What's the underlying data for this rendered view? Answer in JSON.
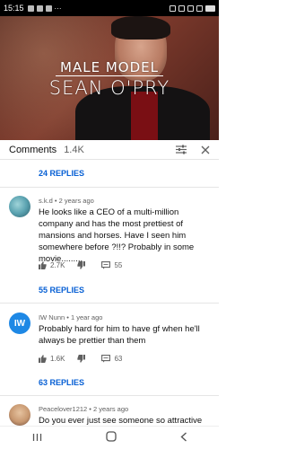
{
  "status_bar": {
    "time": "15:15",
    "battery": "",
    "more": "···"
  },
  "video": {
    "line1": "MALE MODEL",
    "line2": "SEAN O'PRY"
  },
  "comments_header": {
    "title": "Comments",
    "count": "1.4K"
  },
  "comments": [
    {
      "replies_above": "24 REPLIES",
      "author_meta": "s.k.d • 2 years ago",
      "text": "He looks like a CEO of a multi-million company and has the most prettiest of mansions and horses. Have I seen him somewhere before ?!!? Probably in some movie.........",
      "likes": "2.7K",
      "replies_count": "55",
      "replies_link": "55 REPLIES",
      "avatar_letter": ""
    },
    {
      "author_meta": "IW Nunn • 1 year ago",
      "text": "Probably hard for him to have gf when he'll always be prettier than them",
      "likes": "1.6K",
      "replies_count": "63",
      "replies_link": "63 REPLIES",
      "avatar_letter": "IW"
    },
    {
      "author_meta": "Peacelover1212 • 2 years ago",
      "text": "Do you ever just see someone so attractive"
    }
  ],
  "icons": {
    "filter": "filter-sliders-icon",
    "close": "close-icon",
    "like": "thumbs-up-icon",
    "dislike": "thumbs-down-icon",
    "reply": "reply-comment-icon",
    "nav_recents": "recents-icon",
    "nav_home": "home-icon",
    "nav_back": "back-icon"
  },
  "colors": {
    "link_blue": "#065fd4",
    "avatar_blue": "#1e88e5"
  }
}
